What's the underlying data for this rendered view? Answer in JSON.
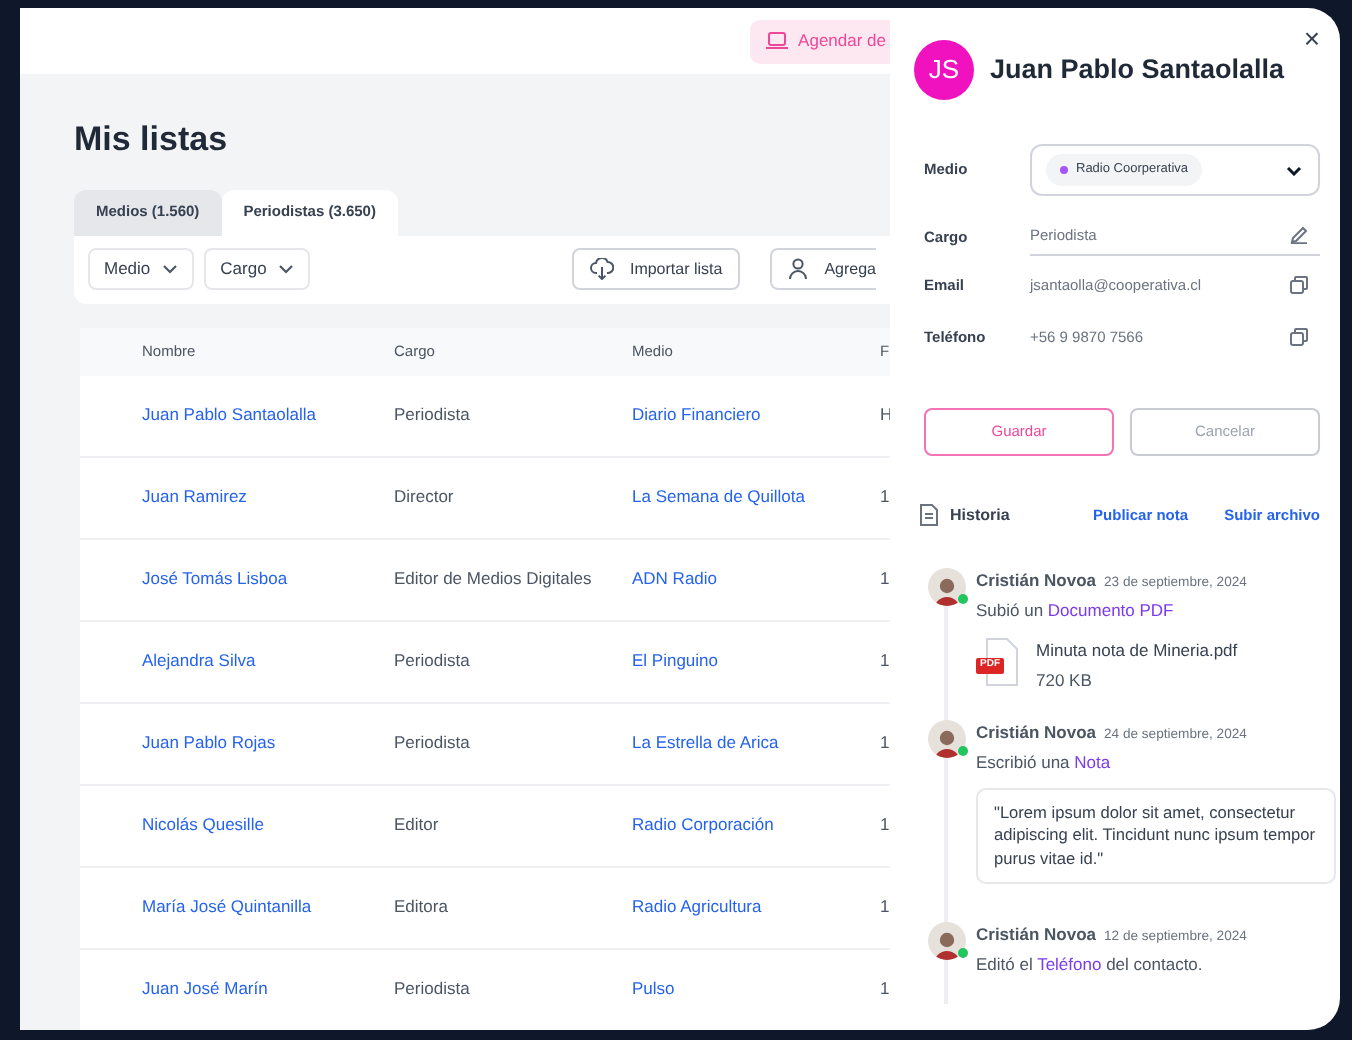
{
  "header": {
    "cta": "Agendar de"
  },
  "page_title": "Mis listas",
  "tabs": [
    {
      "label": "Medios (1.560)",
      "selected": false
    },
    {
      "label": "Periodistas (3.650)",
      "selected": true
    }
  ],
  "filters": [
    "Medio",
    "Cargo"
  ],
  "actions": [
    {
      "label": "Importar lista",
      "kind": "import"
    },
    {
      "label": "Agrega",
      "kind": "add"
    }
  ],
  "table": {
    "columns": [
      "Nombre",
      "Cargo",
      "Medio",
      "F"
    ],
    "rows": [
      {
        "nombre": "Juan Pablo Santaolalla",
        "cargo": "Periodista",
        "medio": "Diario Financiero",
        "column_4": "H"
      },
      {
        "nombre": "Juan Ramirez",
        "cargo": "Director",
        "medio": "La Semana de Quillota",
        "column_4": "1"
      },
      {
        "nombre": "José Tomás Lisboa",
        "cargo": "Editor de Medios Digitales",
        "medio": "ADN Radio",
        "column_4": "1"
      },
      {
        "nombre": "Alejandra Silva",
        "cargo": "Periodista",
        "medio": "El Pinguino",
        "column_4": "1"
      },
      {
        "nombre": "Juan Pablo Rojas",
        "cargo": "Periodista",
        "medio": "La Estrella de Arica",
        "column_4": "1"
      },
      {
        "nombre": "Nicolás Quesille",
        "cargo": "Editor",
        "medio": "Radio Corporación",
        "column_4": "1"
      },
      {
        "nombre": "María José Quintanilla",
        "cargo": "Editora",
        "medio": "Radio Agricultura",
        "column_4": "1"
      },
      {
        "nombre": "Juan José Marín",
        "cargo": "Periodista",
        "medio": "Pulso",
        "column_4": "1"
      }
    ]
  },
  "panel": {
    "close": "×",
    "initials": "JS",
    "name": "Juan Pablo Santaolalla",
    "fields": [
      {
        "label": "Medio",
        "kind": "select",
        "value": "Radio Coorperativa"
      },
      {
        "label": "Cargo",
        "kind": "edit",
        "value": "Periodista"
      },
      {
        "label": "Email",
        "kind": "copy",
        "value": "jsantaolla@cooperativa.cl"
      },
      {
        "label": "Teléfono",
        "kind": "copy",
        "value": "+56 9 9870 7566"
      }
    ],
    "buttons": [
      {
        "label": "Guardar",
        "kind": "primary"
      },
      {
        "label": "Cancelar",
        "kind": "secondary"
      }
    ],
    "history": {
      "title": "Historia",
      "actions": [
        "Publicar nota",
        "Subir archivo"
      ],
      "entries": [
        {
          "author": "Cristián Novoa",
          "date": "23 de septiembre, 2024",
          "online": true,
          "prefix": "Subió un ",
          "link": "Documento PDF",
          "file": {
            "name": "Minuta nota de Mineria.pdf",
            "size": "720 KB",
            "badge": "PDF"
          }
        },
        {
          "author": "Cristián Novoa",
          "date": "24 de septiembre, 2024",
          "online": true,
          "prefix": "Escribió una ",
          "link": "Nota",
          "quote": "\"Lorem ipsum dolor sit amet, consectetur adipiscing elit. Tincidunt nunc ipsum tempor purus vitae id.\""
        },
        {
          "author": "Cristián Novoa",
          "date": "12 de septiembre, 2024",
          "online": true,
          "prefix": "Editó el ",
          "link": "Teléfono",
          "suffix": " del contacto."
        }
      ]
    }
  }
}
